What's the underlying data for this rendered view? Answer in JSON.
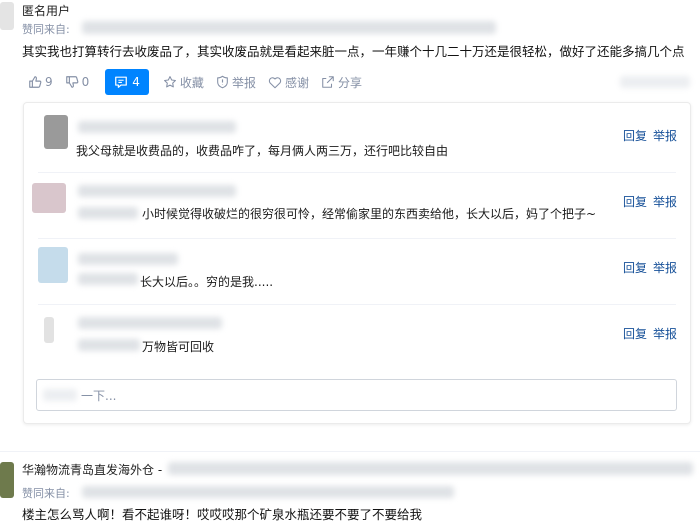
{
  "answer1": {
    "author": "匿名用户",
    "meta_prefix": "赞同来自:",
    "body": "其实我也打算转行去收废品了，其实收废品就是看起来脏一点，一年赚个十几二十万还是很轻松，做好了还能多搞几个点",
    "actions": {
      "upvote_count": "9",
      "downvote_count": "0",
      "comment_count": "4",
      "favorite": "收藏",
      "report": "举报",
      "thanks": "感谢",
      "share": "分享"
    }
  },
  "comments": {
    "items": [
      {
        "text": "我父母就是收费品的，收费品咋了，每月俩人两三万，还行吧比较自由",
        "reply": "回复",
        "report": "举报"
      },
      {
        "text": "小时候觉得收破烂的很穷很可怜，经常偷家里的东西卖给他，长大以后，妈了个把子~",
        "reply": "回复",
        "report": "举报"
      },
      {
        "text": "长大以后。。穷的是我.....",
        "reply": "回复",
        "report": "举报"
      },
      {
        "text": "万物皆可回收",
        "reply": "回复",
        "report": "举报"
      }
    ],
    "input_placeholder": "一下..."
  },
  "answer2": {
    "author": "华瀚物流青岛直发海外仓 -",
    "meta_prefix": "赞同来自:",
    "body": "楼主怎么骂人啊！看不起谁呀！哎哎哎那个矿泉水瓶还要不要了不要给我"
  },
  "colors": {
    "accent": "#0084ff",
    "link": "#175199",
    "muted": "#8590a6"
  }
}
